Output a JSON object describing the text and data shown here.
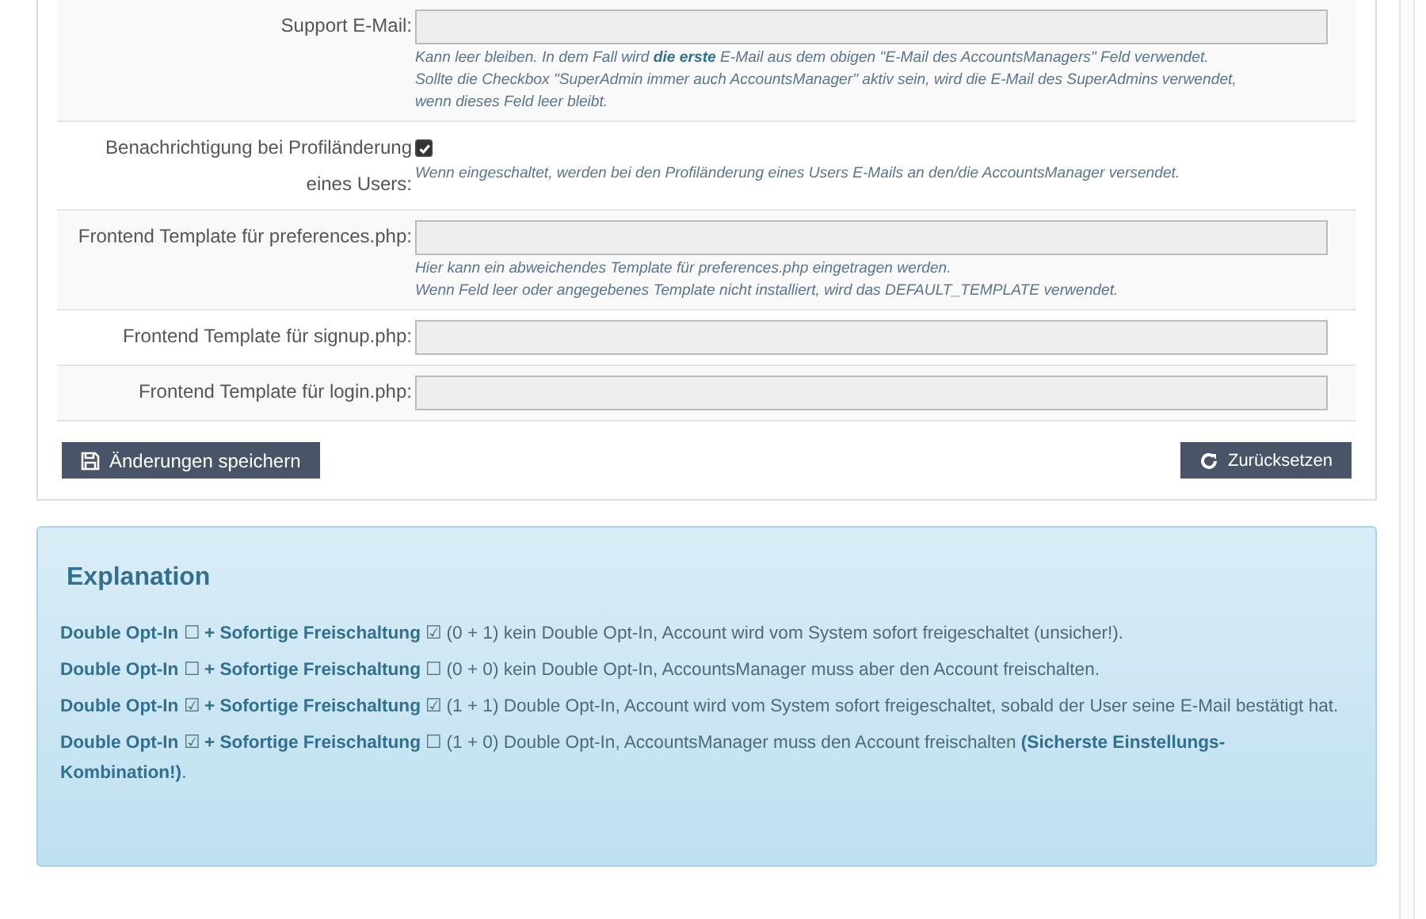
{
  "form": {
    "rows": [
      {
        "kind": "input",
        "label": "Support E-Mail:",
        "help": [
          "Kann leer bleiben. In dem Fall wird **die erste** E-Mail aus dem obigen \"E-Mail des AccountsManagers\" Feld verwendet.",
          "Sollte die Checkbox \"SuperAdmin immer auch AccountsManager\" aktiv sein, wird die E-Mail des SuperAdmins verwendet,",
          "wenn dieses Feld leer bleibt."
        ]
      },
      {
        "kind": "checkbox",
        "label": "Benachrichtigung bei Profiländerung eines Users:",
        "checked": true,
        "help": [
          "Wenn eingeschaltet, werden bei den Profiländerung eines Users E-Mails an den/die AccountsManager versendet."
        ]
      },
      {
        "kind": "input",
        "label": "Frontend Template für preferences.php:",
        "help": [
          "Hier kann ein abweichendes Template für preferences.php eingetragen werden.",
          "Wenn Feld leer oder angegebenes Template nicht installiert, wird das DEFAULT_TEMPLATE verwendet."
        ]
      },
      {
        "kind": "input",
        "label": "Frontend Template für signup.php:"
      },
      {
        "kind": "input",
        "label": "Frontend Template für login.php:"
      }
    ],
    "save_button": "Änderungen speichern",
    "reset_button": "Zurücksetzen"
  },
  "explanation": {
    "title": "Explanation",
    "lines": [
      "**Double Opt-In** ☐ **+ Sofortige Freischaltung** ☑ (0 + 1) kein Double Opt-In, Account wird vom System sofort freigeschaltet (unsicher!).",
      "**Double Opt-In** ☐ **+ Sofortige Freischaltung** ☐ (0 + 0) kein Double Opt-In, AccountsManager muss aber den Account freischalten.",
      "**Double Opt-In** ☑ **+ Sofortige Freischaltung** ☑ (1 + 1) Double Opt-In, Account wird vom System sofort freigeschaltet, sobald der User seine E-Mail bestätigt hat.",
      "**Double Opt-In** ☑ **+ Sofortige Freischaltung** ☐ (1 + 0) Double Opt-In, AccountsManager muss den Account freischalten **(Sicherste Einstellungs-Kombination!)**."
    ]
  }
}
